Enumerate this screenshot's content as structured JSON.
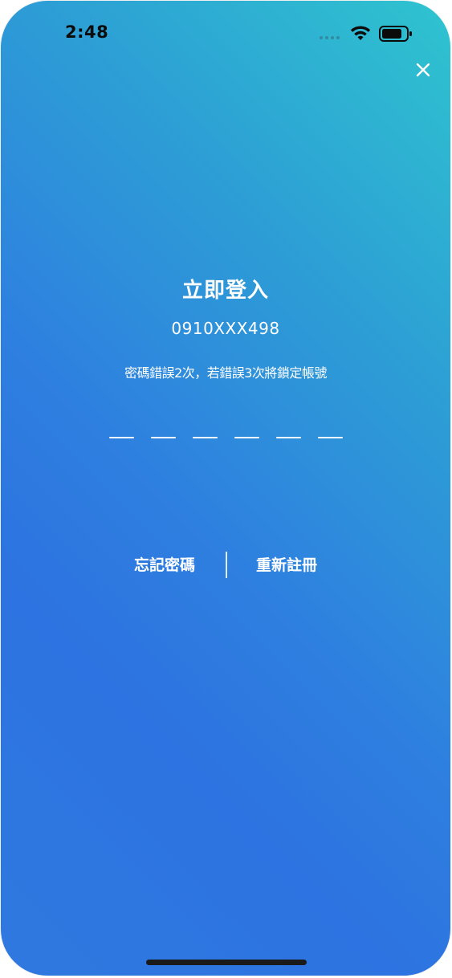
{
  "status_bar": {
    "time": "2:48",
    "icons": [
      "signal-dots-icon",
      "wifi-icon",
      "battery-icon"
    ]
  },
  "close_icon": "close-icon",
  "login": {
    "title": "立即登入",
    "phone": "0910XXX498",
    "warning": "密碼錯誤2次，若錯誤3次將鎖定帳號",
    "pin_length": 6
  },
  "links": {
    "forgot_password": "忘記密碼",
    "register": "重新註冊"
  },
  "colors": {
    "gradient_top_right": "#2ec4cf",
    "gradient_bottom_left": "#2d73e1",
    "text": "#ffffff"
  }
}
